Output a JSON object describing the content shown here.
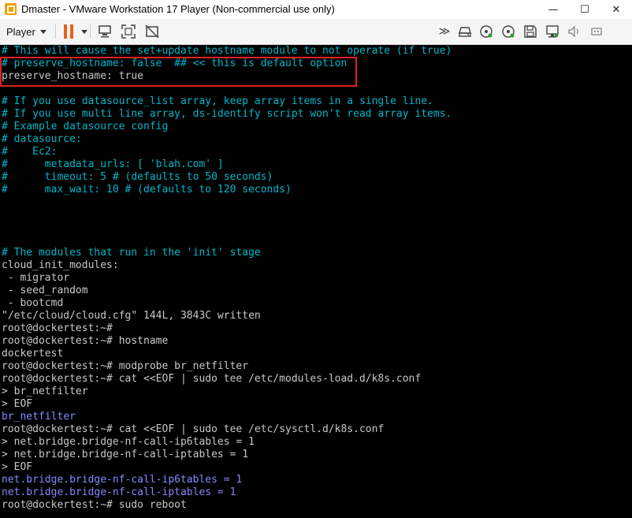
{
  "window": {
    "title": "Dmaster - VMware Workstation 17 Player (Non-commercial use only)",
    "minimize_glyph": "—",
    "maximize_glyph": "☐",
    "close_glyph": "✕"
  },
  "toolbar": {
    "player_menu_label": "Player",
    "icons": [
      "pause-icon",
      "send-ctrl-alt-del-icon",
      "fullscreen-icon",
      "unity-icon",
      "more-icon",
      "hard-disk-icon",
      "cd-dvd-icon",
      "cd-dvd-2-icon",
      "floppy-icon",
      "network-adapter-icon",
      "sound-icon",
      "usb-icon"
    ],
    "more_glyph": "≫"
  },
  "terminal": {
    "colors": {
      "background": "#000000",
      "comment": "#00b7c8",
      "plain": "#c8c8c8",
      "output": "#8888ff",
      "highlight_border": "#e02020"
    },
    "lines": [
      {
        "text": "# This will cause the set+update hostname module to not operate (if true)",
        "style": "comment"
      },
      {
        "text": "# preserve_hostname: false  ## << this is default option",
        "style": "comment"
      },
      {
        "text": "preserve_hostname: true",
        "style": "plain"
      },
      {
        "text": "",
        "style": "plain"
      },
      {
        "text": "# If you use datasource_list array, keep array items in a single line.",
        "style": "comment"
      },
      {
        "text": "# If you use multi line array, ds-identify script won't read array items.",
        "style": "comment"
      },
      {
        "text": "# Example datasource config",
        "style": "comment"
      },
      {
        "text": "# datasource:",
        "style": "comment"
      },
      {
        "text": "#    Ec2:",
        "style": "comment"
      },
      {
        "text": "#      metadata_urls: [ 'blah.com' ]",
        "style": "comment"
      },
      {
        "text": "#      timeout: 5 # (defaults to 50 seconds)",
        "style": "comment"
      },
      {
        "text": "#      max_wait: 10 # (defaults to 120 seconds)",
        "style": "comment"
      },
      {
        "text": "",
        "style": "plain"
      },
      {
        "text": "",
        "style": "plain"
      },
      {
        "text": "",
        "style": "plain"
      },
      {
        "text": "",
        "style": "plain"
      },
      {
        "text": "# The modules that run in the 'init' stage",
        "style": "comment"
      },
      {
        "text": "cloud_init_modules:",
        "style": "plain"
      },
      {
        "text": " - migrator",
        "style": "plain"
      },
      {
        "text": " - seed_random",
        "style": "plain"
      },
      {
        "text": " - bootcmd",
        "style": "plain"
      },
      {
        "text": "\"/etc/cloud/cloud.cfg\" 144L, 3843C written",
        "style": "plain"
      },
      {
        "text": "root@dockertest:~#",
        "style": "plain"
      },
      {
        "text": "root@dockertest:~# hostname",
        "style": "plain"
      },
      {
        "text": "dockertest",
        "style": "plain"
      },
      {
        "text": "root@dockertest:~# modprobe br_netfilter",
        "style": "plain"
      },
      {
        "text": "root@dockertest:~# cat <<EOF | sudo tee /etc/modules-load.d/k8s.conf",
        "style": "plain"
      },
      {
        "text": "> br_netfilter",
        "style": "plain"
      },
      {
        "text": "> EOF",
        "style": "plain"
      },
      {
        "text": "br_netfilter",
        "style": "output"
      },
      {
        "text": "root@dockertest:~# cat <<EOF | sudo tee /etc/sysctl.d/k8s.conf",
        "style": "plain"
      },
      {
        "text": "> net.bridge.bridge-nf-call-ip6tables = 1",
        "style": "plain"
      },
      {
        "text": "> net.bridge.bridge-nf-call-iptables = 1",
        "style": "plain"
      },
      {
        "text": "> EOF",
        "style": "plain"
      },
      {
        "text": "net.bridge.bridge-nf-call-ip6tables = 1",
        "style": "output"
      },
      {
        "text": "net.bridge.bridge-nf-call-iptables = 1",
        "style": "output"
      },
      {
        "text": "root@dockertest:~# sudo reboot",
        "style": "plain"
      }
    ]
  }
}
